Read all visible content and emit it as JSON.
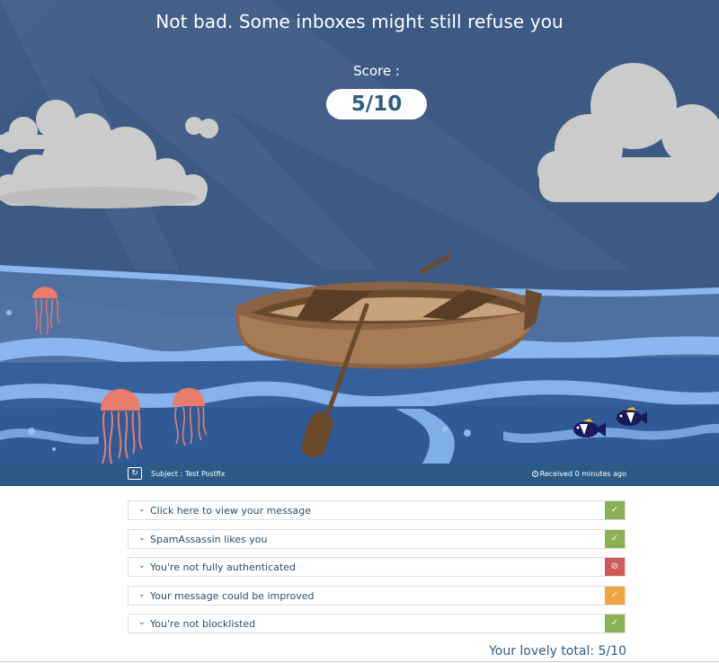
{
  "header": {
    "headline": "Not bad. Some inboxes might still refuse you",
    "score_label": "Score :",
    "score_value": "5/10"
  },
  "info_bar": {
    "refresh_icon": "refresh-icon",
    "subject": "Subject : Test Postfix",
    "clock_icon": "clock-icon",
    "received": "Received 0 minutes ago"
  },
  "results": [
    {
      "label": "Click here to view your message",
      "status": "pass",
      "symbol": "✓",
      "color": "#8bb155"
    },
    {
      "label": "SpamAssassin likes you",
      "status": "pass",
      "symbol": "✓",
      "color": "#8bb155"
    },
    {
      "label": "You're not fully authenticated",
      "status": "fail",
      "symbol": "⊘",
      "color": "#d15b58"
    },
    {
      "label": "Your message could be improved",
      "status": "warn",
      "symbol": "✓",
      "color": "#f2a341"
    },
    {
      "label": "You're not blocklisted",
      "status": "pass",
      "symbol": "✓",
      "color": "#8bb155"
    }
  ],
  "total": "Your lovely total: 5/10",
  "colors": {
    "sky": "#3d5a85",
    "infobar": "#2b5a87",
    "text_blue": "#2e5d86",
    "pass": "#8bb155",
    "fail": "#d15b58",
    "warn": "#f2a341"
  }
}
